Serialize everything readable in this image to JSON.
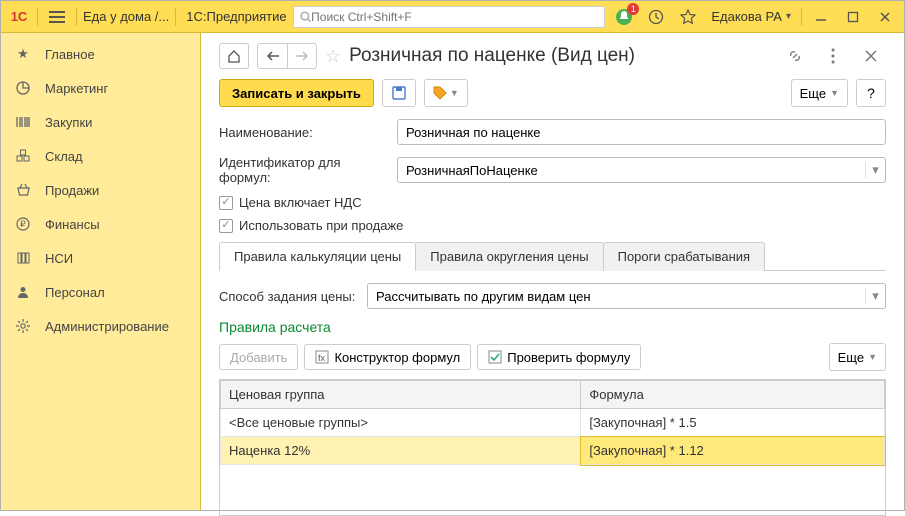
{
  "topbar": {
    "logo_text": "1C",
    "app_title": "Еда у дома /...",
    "platform": "1С:Предприятие",
    "search_placeholder": "Поиск Ctrl+Shift+F",
    "bell_badge": "1",
    "user": "Едакова РА"
  },
  "sidebar": {
    "items": [
      {
        "label": "Главное"
      },
      {
        "label": "Маркетинг"
      },
      {
        "label": "Закупки"
      },
      {
        "label": "Склад"
      },
      {
        "label": "Продажи"
      },
      {
        "label": "Финансы"
      },
      {
        "label": "НСИ"
      },
      {
        "label": "Персонал"
      },
      {
        "label": "Администрирование"
      }
    ]
  },
  "page": {
    "title": "Розничная по наценке (Вид цен)",
    "save_close": "Записать и закрыть",
    "more": "Еще",
    "help": "?",
    "name_label": "Наименование:",
    "name_value": "Розничная по наценке",
    "id_label": "Идентификатор для формул:",
    "id_value": "РозничнаяПоНаценке",
    "chk_vat": "Цена включает НДС",
    "chk_sale": "Использовать при продаже",
    "tabs": [
      "Правила калькуляции цены",
      "Правила округления цены",
      "Пороги срабатывания"
    ],
    "method_label": "Способ задания цены:",
    "method_value": "Рассчитывать по другим видам цен",
    "rules_title": "Правила расчета",
    "btn_add": "Добавить",
    "btn_constructor": "Конструктор формул",
    "btn_check": "Проверить формулу",
    "table": {
      "headers": [
        "Ценовая группа",
        "Формула"
      ],
      "rows": [
        {
          "group": "<Все ценовые группы>",
          "formula": "[Закупочная] * 1.5"
        },
        {
          "group": "Наценка 12%",
          "formula": "[Закупочная] * 1.12"
        }
      ]
    }
  }
}
